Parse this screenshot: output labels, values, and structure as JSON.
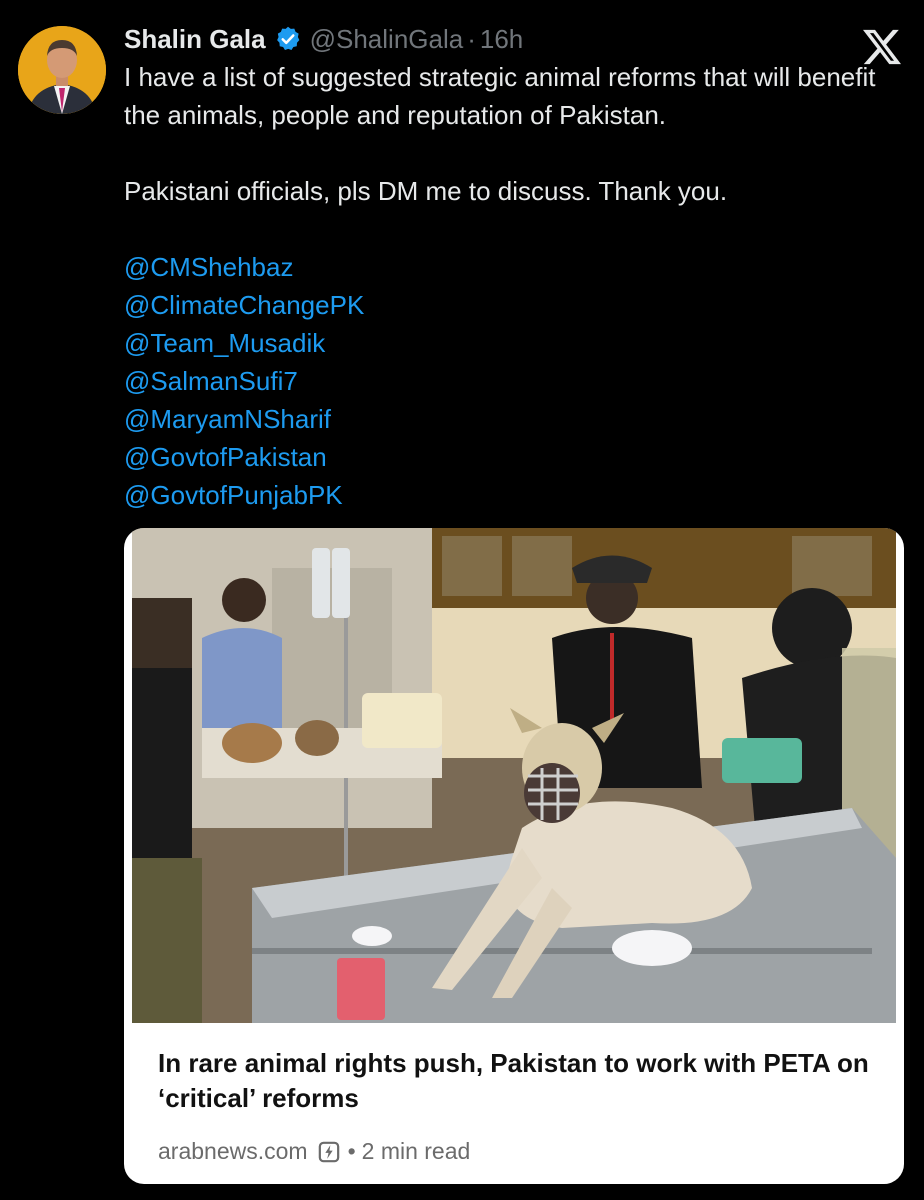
{
  "author": {
    "display_name": "Shalin Gala",
    "handle": "@ShalinGala",
    "separator": "·",
    "timestamp": "16h"
  },
  "tweet": {
    "line1": "I have a list of suggested strategic animal reforms that will benefit the animals, people and reputation of Pakistan.",
    "line2": "Pakistani officials, pls DM me to discuss. Thank you.",
    "mentions": [
      "@CMShehbaz",
      "@ClimateChangePK",
      "@Team_Musadik",
      "@SalmanSufi7",
      "@MaryamNSharif",
      "@GovtofPakistan",
      "@GovtofPunjabPK"
    ]
  },
  "card": {
    "title": "In rare animal rights push, Pakistan to work with PETA on ‘critical’ reforms",
    "source": "arabnews.com",
    "separator": "•",
    "read_time": "2 min read"
  },
  "icons": {
    "verified": "verified-badge-icon",
    "platform_logo": "x-logo-icon",
    "amp": "amp-lightning-icon"
  },
  "colors": {
    "background": "#000000",
    "text_primary": "#e7e9ea",
    "text_secondary": "#71767b",
    "link": "#1d9bf0",
    "verified": "#1d9bf0"
  }
}
